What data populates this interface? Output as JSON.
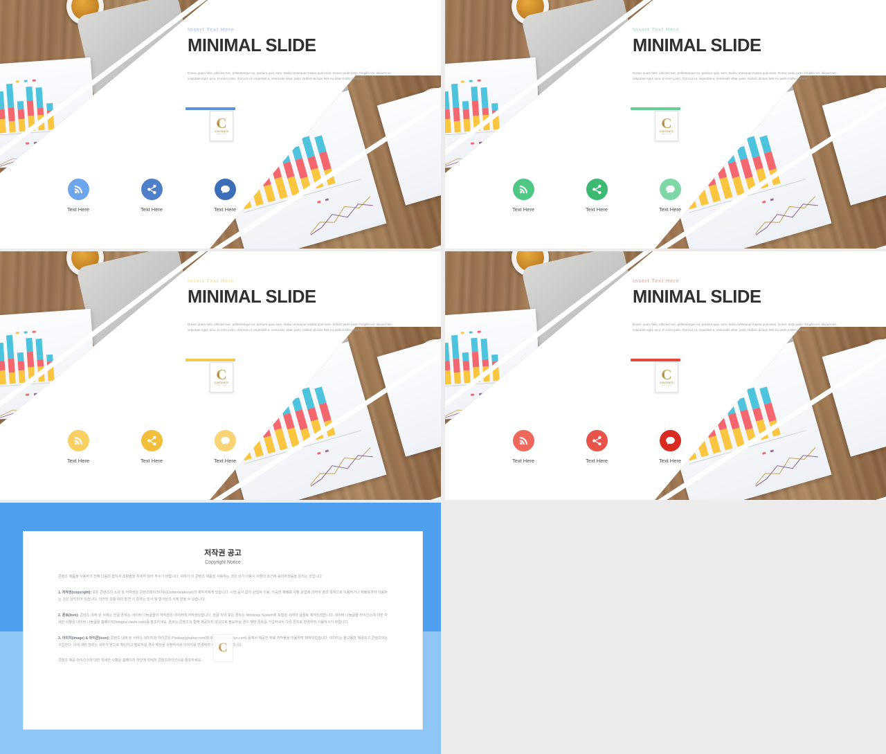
{
  "slides": [
    {
      "id": "slide-blue",
      "kicker": "Insert  Text Here",
      "headline": "MINIMAL SLIDE",
      "body": "Donec quam felis, ultricies nec, pellentesque eu, pretium quis, sem. Nulla consequat massa quis enim. Donec pede justo, fringilla vel, aliquet nec, vulputate eget, arcu. In enim justo, rhoncus ut, imperdiet a, venenatis vitae, justo. Nullam dictum felis eu pede mollis pretium.",
      "accent": "#5b8fe0",
      "kicker_color": "#aec6ef",
      "icons": [
        {
          "name": "rss-icon",
          "label": "Text Here",
          "color": "#6ea5ef"
        },
        {
          "name": "share-icon",
          "label": "Text Here",
          "color": "#4f7fc9"
        },
        {
          "name": "chat-icon",
          "label": "Text Here",
          "color": "#3d6eb8"
        }
      ]
    },
    {
      "id": "slide-green",
      "kicker": "Insert  Text Here",
      "headline": "MINIMAL SLIDE",
      "body": "Donec quam felis, ultricies nec, pellentesque eu, pretium quis, sem. Nulla consequat massa quis enim. Donec pede justo, fringilla vel, aliquet nec, vulputate eget, arcu. In enim justo, rhoncus ut, imperdiet a, venenatis vitae, justo. Nullam dictum felis eu pede mollis pretium.",
      "accent": "#62cf94",
      "kicker_color": "#a8e2c2",
      "icons": [
        {
          "name": "rss-icon",
          "label": "Text Here",
          "color": "#4ec684"
        },
        {
          "name": "share-icon",
          "label": "Text Here",
          "color": "#3cba74"
        },
        {
          "name": "chat-icon",
          "label": "Text Here",
          "color": "#7fd6a6"
        }
      ]
    },
    {
      "id": "slide-yellow",
      "kicker": "Insert  Text Here",
      "headline": "MINIMAL SLIDE",
      "body": "Donec quam felis, ultricies nec, pellentesque eu, pretium quis, sem. Nulla consequat massa quis enim. Donec pede justo, fringilla vel, aliquet nec, vulputate eget, arcu. In enim justo, rhoncus ut, imperdiet a, venenatis vitae, justo. Nullam dictum felis eu pede mollis pretium.",
      "accent": "#f2c94c",
      "kicker_color": "#f5dd9a",
      "icons": [
        {
          "name": "rss-icon",
          "label": "Text Here",
          "color": "#f7cf63"
        },
        {
          "name": "share-icon",
          "label": "Text Here",
          "color": "#f1bf3c"
        },
        {
          "name": "chat-icon",
          "label": "Text Here",
          "color": "#f8d476"
        }
      ]
    },
    {
      "id": "slide-red",
      "kicker": "Insert  Text Here",
      "headline": "MINIMAL SLIDE",
      "body": "Donec quam felis, ultricies nec, pellentesque eu, pretium quis, sem. Nulla consequat massa quis enim. Donec pede justo, fringilla vel, aliquet nec, vulputate eget, arcu. In enim justo, rhoncus ut, imperdiet a, venenatis vitae, justo. Nullam dictum felis eu pede mollis pretium.",
      "accent": "#e8463c",
      "kicker_color": "#f0a69f",
      "icons": [
        {
          "name": "rss-icon",
          "label": "Text Here",
          "color": "#f0675c"
        },
        {
          "name": "share-icon",
          "label": "Text Here",
          "color": "#e8534a"
        },
        {
          "name": "chat-icon",
          "label": "Text Here",
          "color": "#d92b20"
        }
      ]
    }
  ],
  "logo": {
    "letter": "C",
    "name": "CONTENTS",
    "sub": "MALL ONE"
  },
  "copyright": {
    "title_ko": "저작권 공고",
    "title_en": "Copyright Notice",
    "intro": "콘텐츠 제품을 사용하기 전에 다음의 합의서 조항들을 자세히 읽어 주시기 바랍니다. 귀하가 이 콘텐츠 제품을 사용하는 것은 상기 사용시 사항의 조건에 동의하셨음을 알리는 것입니다.",
    "paragraphs": [
      {
        "lead": "1. 저작권(copyright):",
        "text": " 모든 콘텐츠의 소유 및 저작권은 콘텐츠테이크아웃(Contentstakeout)의 제작자에게 있습니다. 사전 승낙 없이 상업적 이용, 가공한 재배포 사항 상업에 의하여 영리 목적으로 이용하거나 재배포하여 이용하는 것은 금지되어 있습니다. 이러한 조항 위반 발견 시 준하는 민사 및 형사상의 사제 받을 수 있습니다."
      },
      {
        "lead": "2. 폰트(font):",
        "text": " 콘텐츠 내에 된 서체는 한글 폰트는 네이버 나눔글꼴의 저작권은 네이버에 저작권있습니다. 한글 외의 모든 폰트는 Windows System에 포함된 서체의 글꼴로 제작되었습니다. 네이버 나눔글꼴 라이선스에 대한 자세한 사항은 네이버 나눔글꼴 홈페이지(hangeul.naver.com)를 참조하세요. 폰트는 콘텐츠의 함께 제공되지 않으므로 필요하실 경우 해당 폰트를 가입하셔서 다른 폰트로 변경하여 사용하시기 바랍니다."
      },
      {
        "lead": "3. 이미지(image) & 아이콘(icon):",
        "text": " 콘텐츠 내에 된 서비스 이미지와 아이콘은 Pixabay(pixabay.com)와 Webalys(webalys.com) 등에서 제공한 무료 저작물을 이용하여 제작되었습니다. 이미지는 참고용만 제공되고 콘텐츠의는 구입한다. 이에 대한 권리는 귀하가 받으로 확인하고 필요하실 경우 해당을 수정하셔서 이미지를 변경하여 사용하시기 바랍니다."
      }
    ],
    "footer": "콘텐츠 제공 라이선스에 대한 자세한 사항은 홈페이지 하단에 자세히 콘텐츠라이선스를 참조하세요."
  }
}
